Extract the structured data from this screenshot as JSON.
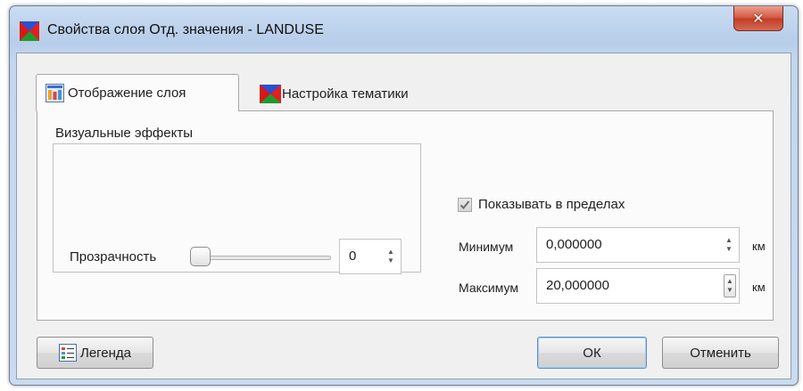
{
  "window": {
    "title": "Свойства слоя Отд. значения - LANDUSE",
    "close_glyph": "✕"
  },
  "tabs": [
    {
      "label": "Отображение слоя",
      "icon": "layer-display-icon",
      "active": true
    },
    {
      "label": "Настройка тематики",
      "icon": "thematic-icon",
      "active": false
    }
  ],
  "visual_effects": {
    "group_title": "Визуальные эффекты",
    "transparency_label": "Прозрачность",
    "transparency_value": "0",
    "slider_fraction": 0
  },
  "visibility_range": {
    "checkbox_label": "Показывать в пределах",
    "checked": true,
    "min_label": "Минимум",
    "min_value": "0,000000",
    "max_label": "Максимум",
    "max_value": "20,000000",
    "unit": "км"
  },
  "buttons": {
    "legend": "Легенда",
    "ok": "ОК",
    "cancel": "Отменить"
  },
  "colors": {
    "accent": "#5d8fc9",
    "close_red": "#c23d26"
  }
}
